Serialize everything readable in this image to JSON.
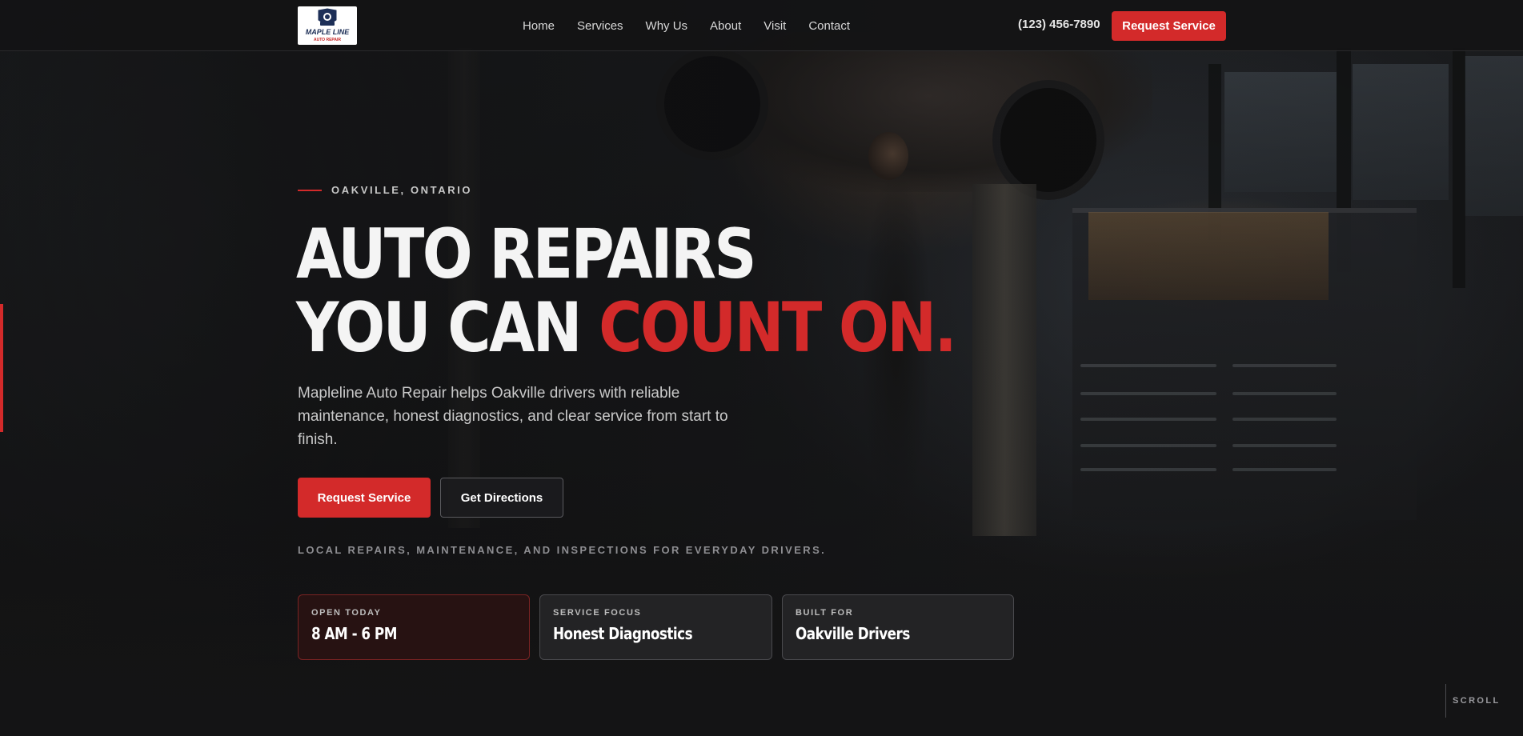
{
  "brand": {
    "logo_text_top": "MAPLE LINE",
    "logo_text_bottom": "AUTO REPAIR",
    "colors": {
      "accent": "#d32a2a",
      "background": "#141415"
    }
  },
  "nav": {
    "links": [
      "Home",
      "Services",
      "Why Us",
      "About",
      "Visit",
      "Contact"
    ],
    "phone": "(123) 456-7890",
    "cta_label": "Request Service"
  },
  "hero": {
    "eyebrow": "OAKVILLE, ONTARIO",
    "headline_line1": "AUTO REPAIRS",
    "headline_line2_white": "YOU CAN ",
    "headline_line2_red": "COUNT ON.",
    "lead": "Mapleline Auto Repair helps Oakville drivers with reliable maintenance, honest diagnostics, and clear service from start to finish.",
    "primary_button": "Request Service",
    "secondary_button": "Get Directions",
    "tagline": "LOCAL REPAIRS, MAINTENANCE, AND INSPECTIONS FOR EVERYDAY DRIVERS."
  },
  "cards": [
    {
      "label": "OPEN TODAY",
      "value": "8 AM - 6 PM"
    },
    {
      "label": "SERVICE FOCUS",
      "value": "Honest Diagnostics"
    },
    {
      "label": "BUILT FOR",
      "value": "Oakville Drivers"
    }
  ],
  "scroll_label": "SCROLL"
}
